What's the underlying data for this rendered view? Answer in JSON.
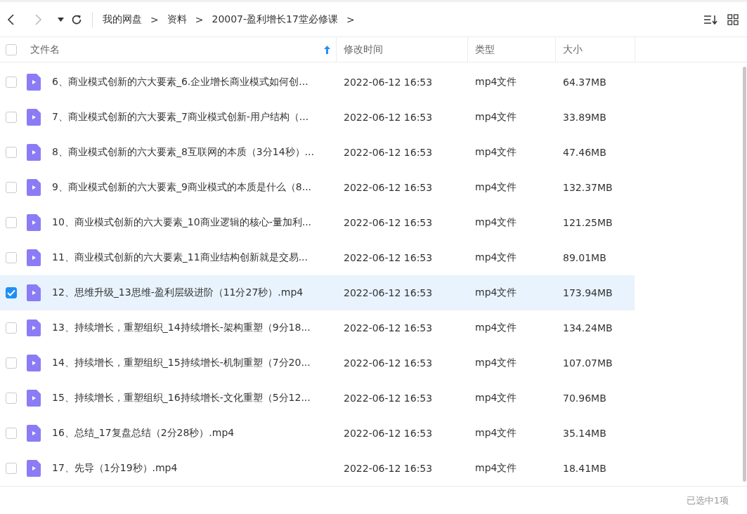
{
  "toolbar": {
    "breadcrumbs": [
      {
        "label": "我的网盘",
        "separator": ">"
      },
      {
        "label": "资料",
        "separator": ">"
      },
      {
        "label": "20007-盈利增长17堂必修课",
        "separator": ">"
      }
    ]
  },
  "table": {
    "select_all_checked": false,
    "columns": [
      {
        "label": "文件名",
        "sorted": true
      },
      {
        "label": "修改时间",
        "sorted": false
      },
      {
        "label": "类型",
        "sorted": false
      },
      {
        "label": "大小",
        "sorted": false
      }
    ],
    "rows": [
      {
        "name": "6、商业模式创新的六大要素_6.企业增长商业模式如何创...",
        "modified": "2022-06-12 16:53",
        "type": "mp4文件",
        "size": "64.37MB",
        "selected": false
      },
      {
        "name": "7、商业模式创新的六大要素_7商业模式创新-用户结构（...",
        "modified": "2022-06-12 16:53",
        "type": "mp4文件",
        "size": "33.89MB",
        "selected": false
      },
      {
        "name": "8、商业模式创新的六大要素_8互联网的本质（3分14秒）...",
        "modified": "2022-06-12 16:53",
        "type": "mp4文件",
        "size": "47.46MB",
        "selected": false
      },
      {
        "name": "9、商业模式创新的六大要素_9商业模式的本质是什么（8...",
        "modified": "2022-06-12 16:53",
        "type": "mp4文件",
        "size": "132.37MB",
        "selected": false
      },
      {
        "name": "10、商业模式创新的六大要素_10商业逻辑的核心-量加利...",
        "modified": "2022-06-12 16:53",
        "type": "mp4文件",
        "size": "121.25MB",
        "selected": false
      },
      {
        "name": "11、商业模式创新的六大要素_11商业结构创新就是交易...",
        "modified": "2022-06-12 16:53",
        "type": "mp4文件",
        "size": "89.01MB",
        "selected": false
      },
      {
        "name": "12、思维升级_13思维-盈利层级进阶（11分27秒）.mp4",
        "modified": "2022-06-12 16:53",
        "type": "mp4文件",
        "size": "173.94MB",
        "selected": true
      },
      {
        "name": "13、持续增长，重塑组织_14持续增长-架构重塑（9分18...",
        "modified": "2022-06-12 16:53",
        "type": "mp4文件",
        "size": "134.24MB",
        "selected": false
      },
      {
        "name": "14、持续增长，重塑组织_15持续增长-机制重塑（7分20...",
        "modified": "2022-06-12 16:53",
        "type": "mp4文件",
        "size": "107.07MB",
        "selected": false
      },
      {
        "name": "15、持续增长，重塑组织_16持续增长-文化重塑（5分12...",
        "modified": "2022-06-12 16:53",
        "type": "mp4文件",
        "size": "70.96MB",
        "selected": false
      },
      {
        "name": "16、总结_17复盘总结（2分28秒）.mp4",
        "modified": "2022-06-12 16:53",
        "type": "mp4文件",
        "size": "35.14MB",
        "selected": false
      },
      {
        "name": "17、先导（1分19秒）.mp4",
        "modified": "2022-06-12 16:53",
        "type": "mp4文件",
        "size": "18.41MB",
        "selected": false
      }
    ]
  },
  "status_bar": {
    "selection": "已选中1项"
  }
}
